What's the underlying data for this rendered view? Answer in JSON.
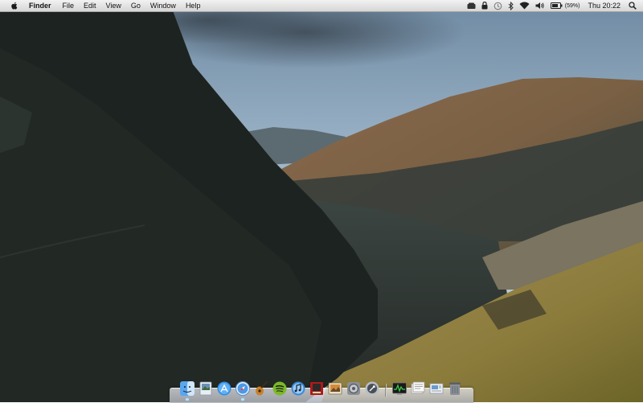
{
  "menubar": {
    "app_name": "Finder",
    "menus": [
      "File",
      "Edit",
      "View",
      "Go",
      "Window",
      "Help"
    ],
    "status": {
      "battery_percent": "(59%)",
      "clock": "Thu 20:22"
    }
  },
  "dock": {
    "apps": [
      {
        "name": "finder",
        "running": true
      },
      {
        "name": "preview",
        "running": false
      },
      {
        "name": "app-store",
        "running": false
      },
      {
        "name": "safari",
        "running": true
      },
      {
        "name": "garageband",
        "running": false
      },
      {
        "name": "spotify",
        "running": false
      },
      {
        "name": "itunes",
        "running": false
      },
      {
        "name": "photo-booth",
        "running": false
      },
      {
        "name": "iphoto",
        "running": false
      },
      {
        "name": "system-preferences",
        "running": false
      },
      {
        "name": "utility",
        "running": false
      }
    ],
    "docs": [
      {
        "name": "activity-monitor"
      },
      {
        "name": "documents-stack"
      },
      {
        "name": "downloads-stack"
      },
      {
        "name": "trash"
      }
    ]
  },
  "colors": {
    "menubar_top": "#f2f2f2",
    "menubar_bottom": "#d6d6d6",
    "sky": "#9ab6cc",
    "mountain_dark": "#1f2522",
    "grass": "#8a7a3a"
  }
}
